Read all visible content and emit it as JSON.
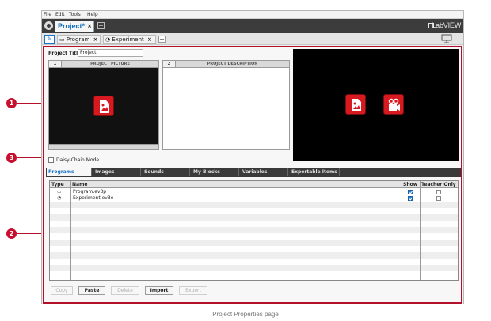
{
  "menu": [
    "File",
    "Edit",
    "Tools",
    "Help"
  ],
  "project_tab": {
    "label": "Project*",
    "close": "×",
    "add": "+"
  },
  "brand": "LabVIEW",
  "program_tabs": [
    {
      "label": "Program",
      "close": "×"
    },
    {
      "label": "Experiment",
      "close": "×"
    }
  ],
  "tabbar_add": "+",
  "project_title": {
    "label": "Project Title:",
    "value": "Project"
  },
  "panels": {
    "picture": {
      "number": "1",
      "title": "PROJECT PICTURE"
    },
    "description": {
      "number": "2",
      "title": "PROJECT DESCRIPTION"
    }
  },
  "daisy_chain": {
    "label": "Daisy-Chain Mode",
    "checked": false
  },
  "bottom_tabs": [
    "Programs",
    "Images",
    "Sounds",
    "My Blocks",
    "Variables",
    "Exportable Items"
  ],
  "active_bottom_tab": "Programs",
  "grid": {
    "headers": {
      "type": "Type",
      "name": "Name",
      "show": "Show",
      "teacher": "Teacher Only"
    },
    "rows": [
      {
        "type_icon": "program-file-icon",
        "name": "Program.ev3p",
        "show": true,
        "teacher_only": false
      },
      {
        "type_icon": "experiment-file-icon",
        "name": "Experiment.ev3e",
        "show": true,
        "teacher_only": false
      }
    ]
  },
  "buttons": {
    "copy": "Copy",
    "paste": "Paste",
    "delete": "Delete",
    "import": "Import",
    "export": "Export"
  },
  "callouts": [
    "1",
    "2",
    "3"
  ],
  "caption": "Project Properties page",
  "colors": {
    "accent": "#1a73c9",
    "callout": "#c8102e",
    "icon_red": "#d71920",
    "dark": "#3c3c3c"
  }
}
